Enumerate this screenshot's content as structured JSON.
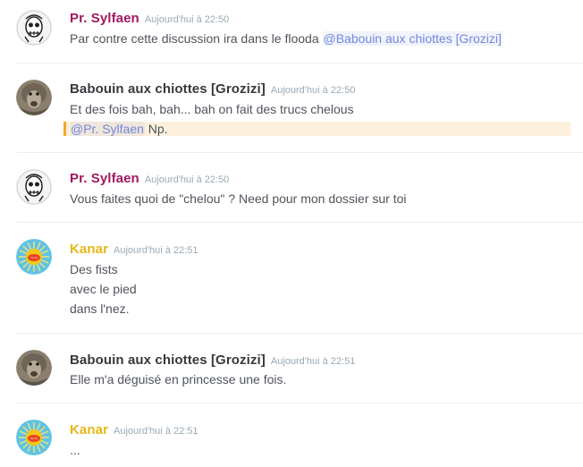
{
  "messages": [
    {
      "author": "Pr. Sylfaen",
      "author_color": "#a1185e",
      "avatar_icon": "skull-avatar-icon",
      "timestamp": "Aujourd'hui à 22:50",
      "lines": [
        {
          "text": "Par contre cette discussion ira dans le flooda ",
          "mention": "@Babouin aux chiottes [Grozizi]"
        }
      ]
    },
    {
      "author": "Babouin aux chiottes [Grozizi]",
      "author_color": "#36393e",
      "avatar_icon": "baboon-avatar-icon",
      "timestamp": "Aujourd'hui à 22:50",
      "lines": [
        {
          "text": "Et des fois bah, bah... bah on fait des trucs chelous"
        },
        {
          "mention": "@Pr. Sylfaen",
          "text_after": " Np.",
          "highlighted": true
        }
      ]
    },
    {
      "author": "Pr. Sylfaen",
      "author_color": "#a1185e",
      "avatar_icon": "skull-avatar-icon",
      "timestamp": "Aujourd'hui à 22:50",
      "lines": [
        {
          "text": "Vous faites quoi de \"chelou\" ? Need pour mon dossier sur toi"
        }
      ]
    },
    {
      "author": "Kanar",
      "author_color": "#e6b616",
      "avatar_icon": "sun-logo-avatar-icon",
      "timestamp": "Aujourd'hui à 22:51",
      "lines": [
        {
          "text": "Des fists"
        },
        {
          "text": "avec le pied"
        },
        {
          "text": "dans l'nez."
        }
      ]
    },
    {
      "author": "Babouin aux chiottes [Grozizi]",
      "author_color": "#36393e",
      "avatar_icon": "baboon-avatar-icon",
      "timestamp": "Aujourd'hui à 22:51",
      "lines": [
        {
          "text": "Elle m'a déguisé en princesse une fois."
        }
      ]
    },
    {
      "author": "Kanar",
      "author_color": "#e6b616",
      "avatar_icon": "sun-logo-avatar-icon",
      "timestamp": "Aujourd'hui à 22:51",
      "lines": [
        {
          "text": "..."
        }
      ]
    }
  ]
}
